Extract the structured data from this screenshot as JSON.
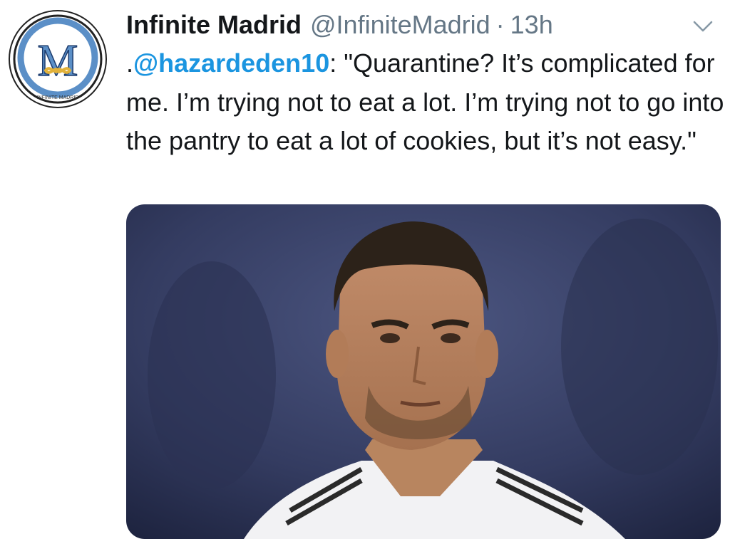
{
  "tweet": {
    "author_name": "Infinite Madrid",
    "author_handle": "@InfiniteMadrid",
    "separator": "·",
    "time": "13h",
    "text_prefix": ".",
    "mention": "@hazardeden10",
    "text_body": ": \"Quarantine? It’s complicated for me. I’m trying not to eat a lot. I’m trying not to go into the pantry to eat a lot of cookies, but it’s not easy.\"",
    "avatar": {
      "monogram": "M",
      "ring_caption": "INFINITE MADRID"
    }
  },
  "icons": {
    "more": "chevron-down-icon",
    "logo": "infinite-madrid-logo"
  },
  "colors": {
    "text": "#14171a",
    "muted": "#657786",
    "link": "#1b95e0",
    "logo_blue": "#5b8fc7",
    "logo_gold": "#e2b23a"
  }
}
